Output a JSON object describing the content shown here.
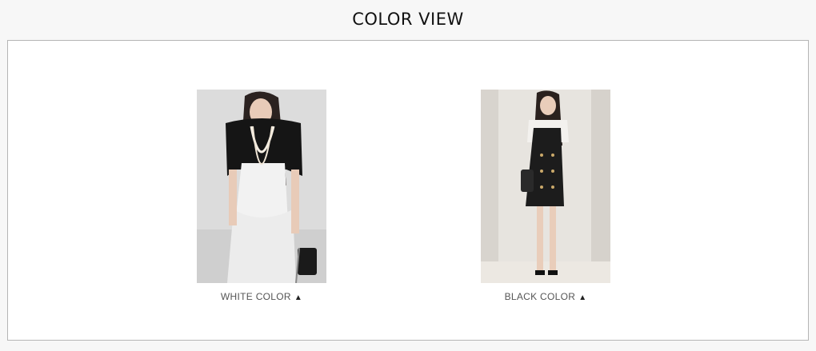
{
  "header": {
    "title": "COLOR VIEW"
  },
  "colors": [
    {
      "label": "WHITE COLOR",
      "arrow": "▲",
      "photo_alt": "white-dress-photo"
    },
    {
      "label": "BLACK COLOR",
      "arrow": "▲",
      "photo_alt": "black-dress-photo"
    }
  ]
}
